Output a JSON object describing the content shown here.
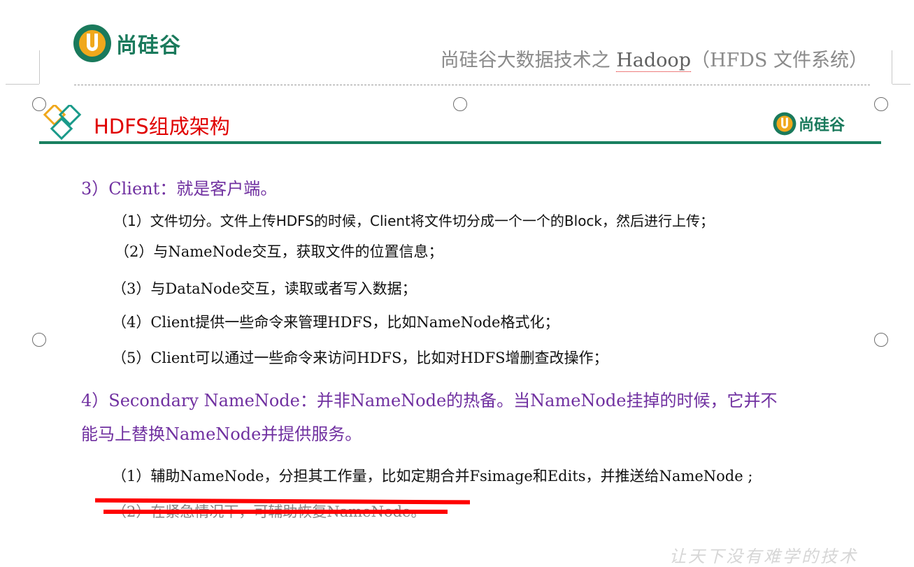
{
  "header": {
    "logo_text": "尚硅谷",
    "doc_title_prefix": "尚硅谷大数据技术之 ",
    "doc_title_keyword": "Hadoop",
    "doc_title_suffix": "（HFDS 文件系统）"
  },
  "slide": {
    "title": "HDFS组成架构",
    "logo_text": "尚硅谷"
  },
  "content": {
    "client_heading": "3）Client：就是客户端。",
    "client_items": [
      "（1）文件切分。文件上传HDFS的时候，Client将文件切分成一个一个的Block，然后进行上传；",
      "（2）与NameNode交互，获取文件的位置信息；",
      "（3）与DataNode交互，读取或者写入数据；",
      "（4）Client提供一些命令来管理HDFS，比如NameNode格式化；",
      "（5）Client可以通过一些命令来访问HDFS，比如对HDFS增删查改操作；"
    ],
    "secondary_heading_line1": "4）Secondary NameNode：并非NameNode的热备。当NameNode挂掉的时候，它并不",
    "secondary_heading_line2": "能马上替换NameNode并提供服务。",
    "secondary_items": [
      "（1）辅助NameNode，分担其工作量，比如定期合并Fsimage和Edits，并推送给NameNode ;",
      "（2）在紧急情况下，可辅助恢复NameNode。"
    ]
  },
  "footer": {
    "watermark": "让天下没有难学的技术"
  },
  "colors": {
    "brand_green": "#1a7a5c",
    "title_red": "#e00000",
    "heading_purple": "#7030a0",
    "strike_red": "#ff0000"
  }
}
